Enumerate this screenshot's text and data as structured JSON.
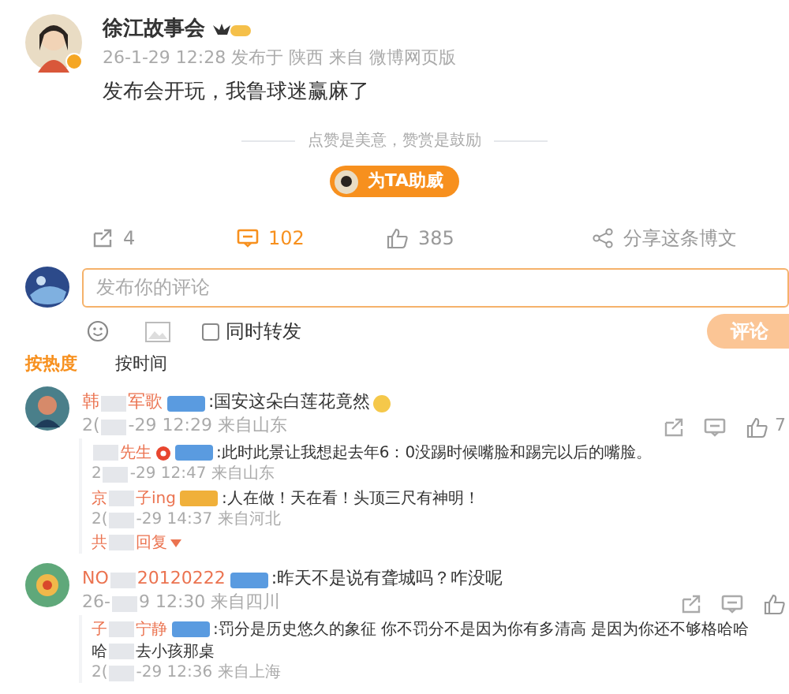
{
  "post": {
    "author": "徐江故事会",
    "meta": "26-1-29 12:28 发布于 陕西 来自 微博网页版",
    "text": "发布会开玩，我鲁球迷赢麻了"
  },
  "reward": {
    "note": "点赞是美意，赞赏是鼓励",
    "button": "为TA助威"
  },
  "actions": [
    {
      "kind": "repost",
      "count": "4",
      "selected": false
    },
    {
      "kind": "comment",
      "count": "102",
      "selected": true
    },
    {
      "kind": "like",
      "count": "385",
      "selected": false
    },
    {
      "kind": "share",
      "count": "分享这条博文",
      "selected": false
    }
  ],
  "composer": {
    "placeholder": "发布你的评论",
    "also_repost": {
      "label": "同时转发",
      "checked": false
    },
    "submit": "评论"
  },
  "sort_tabs": [
    {
      "label": "按热度",
      "selected": true
    },
    {
      "label": "按时间",
      "selected": false
    }
  ],
  "comments": [
    {
      "name": [
        {
          "kind": "text",
          "text": "韩"
        },
        {
          "kind": "redacted"
        },
        {
          "kind": "text",
          "text": "军歌"
        }
      ],
      "badge": {
        "color": "#5a9be0"
      },
      "text": ":国安这朵白莲花竟然",
      "emoji": true,
      "date": [
        {
          "kind": "text",
          "text": "2("
        },
        {
          "kind": "redacted"
        },
        {
          "kind": "text",
          "text": "-29 12:29 来自山东"
        }
      ],
      "like_count": "7",
      "replies": [
        {
          "name": [
            {
              "kind": "redacted"
            },
            {
              "kind": "text",
              "text": "先生"
            }
          ],
          "red_badge": true,
          "badge": {
            "color": "#5a9be0"
          },
          "lines": [
            [
              {
                "kind": "text",
                "text": ":此时此景让我想起去年6：0没踢时候嘴脸和踢完以后的嘴脸。"
              }
            ]
          ],
          "date": [
            {
              "kind": "text",
              "text": "2"
            },
            {
              "kind": "redacted"
            },
            {
              "kind": "text",
              "text": "-29 12:47 来自山东"
            }
          ]
        },
        {
          "name": [
            {
              "kind": "text",
              "text": "京"
            },
            {
              "kind": "redacted"
            },
            {
              "kind": "text",
              "text": "子ing"
            }
          ],
          "red_badge": false,
          "badge": {
            "color": "#f0b03a"
          },
          "lines": [
            [
              {
                "kind": "text",
                "text": ":人在做！天在看！头顶三尺有神明！"
              }
            ]
          ],
          "date": [
            {
              "kind": "text",
              "text": "2("
            },
            {
              "kind": "redacted"
            },
            {
              "kind": "text",
              "text": "-29 14:37 来自河北"
            }
          ]
        }
      ],
      "more_replies": [
        {
          "kind": "text",
          "text": "共"
        },
        {
          "kind": "redacted"
        },
        {
          "kind": "text",
          "text": "回复"
        }
      ]
    },
    {
      "name": [
        {
          "kind": "text",
          "text": "NO"
        },
        {
          "kind": "redacted"
        },
        {
          "kind": "text",
          "text": "20120222"
        }
      ],
      "badge": {
        "color": "#5a9be0"
      },
      "text": ":昨天不是说有聋城吗？咋没呢",
      "emoji": false,
      "date": [
        {
          "kind": "text",
          "text": "26-"
        },
        {
          "kind": "redacted"
        },
        {
          "kind": "text",
          "text": "9 12:30 来自四川"
        }
      ],
      "replies": [
        {
          "name": [
            {
              "kind": "text",
              "text": "子"
            },
            {
              "kind": "redacted"
            },
            {
              "kind": "text",
              "text": "宁静"
            }
          ],
          "red_badge": false,
          "badge": {
            "color": "#5a9be0"
          },
          "lines": [
            [
              {
                "kind": "text",
                "text": ":罚分是历史悠久的象征 你不罚分不是因为你有多清高 是因为你还不够格哈哈"
              }
            ],
            [
              {
                "kind": "text",
                "text": "哈"
              },
              {
                "kind": "redacted"
              },
              {
                "kind": "text",
                "text": "去小孩那桌"
              }
            ]
          ],
          "date": [
            {
              "kind": "text",
              "text": "2("
            },
            {
              "kind": "redacted"
            },
            {
              "kind": "text",
              "text": "-29 12:36 来自上海"
            }
          ]
        }
      ]
    }
  ]
}
